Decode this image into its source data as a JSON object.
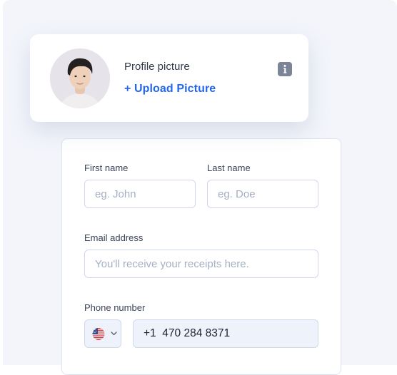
{
  "profile": {
    "label": "Profile picture",
    "upload_label": "+ Upload Picture"
  },
  "form": {
    "first_name": {
      "label": "First name",
      "placeholder": "eg. John",
      "value": ""
    },
    "last_name": {
      "label": "Last name",
      "placeholder": "eg. Doe",
      "value": ""
    },
    "email": {
      "label": "Email address",
      "placeholder": "You'll receive your receipts here.",
      "value": ""
    },
    "phone": {
      "label": "Phone number",
      "value": "+1  470 284 8371",
      "country": "US"
    }
  },
  "colors": {
    "accent": "#2366f0",
    "background": "#f3f5fb",
    "input_border": "#cfd8ec",
    "info_icon": "#7b8597"
  },
  "icons": {
    "info": "info-icon",
    "flag": "us-flag-icon",
    "chevron": "chevron-down-icon"
  }
}
